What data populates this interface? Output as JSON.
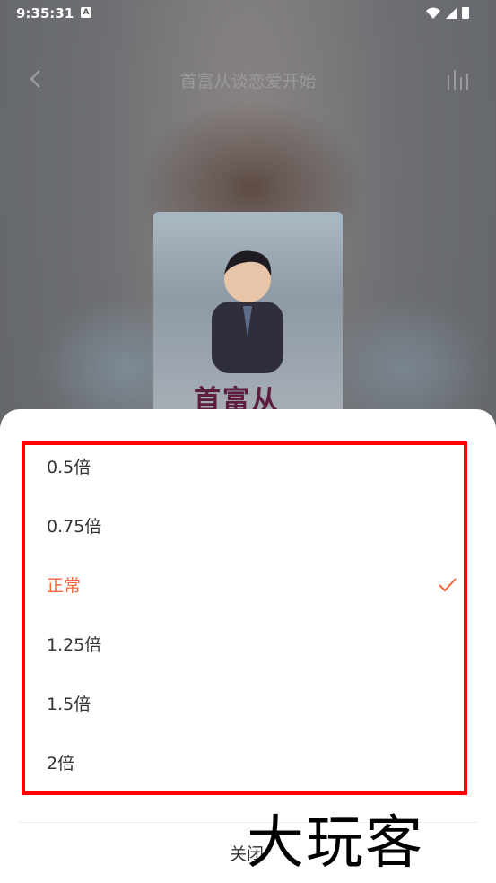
{
  "status": {
    "time": "9:35:31",
    "notif_letter": "A"
  },
  "header": {
    "title": "首富从谈恋爱开始"
  },
  "cover": {
    "title_text": "首富从"
  },
  "speed_sheet": {
    "options": [
      {
        "label": "0.5倍",
        "selected": false
      },
      {
        "label": "0.75倍",
        "selected": false
      },
      {
        "label": "正常",
        "selected": true
      },
      {
        "label": "1.25倍",
        "selected": false
      },
      {
        "label": "1.5倍",
        "selected": false
      },
      {
        "label": "2倍",
        "selected": false
      }
    ],
    "close_label": "关闭"
  },
  "watermark": "大玩客",
  "colors": {
    "accent": "#f4693c",
    "highlight": "#ff0000"
  }
}
